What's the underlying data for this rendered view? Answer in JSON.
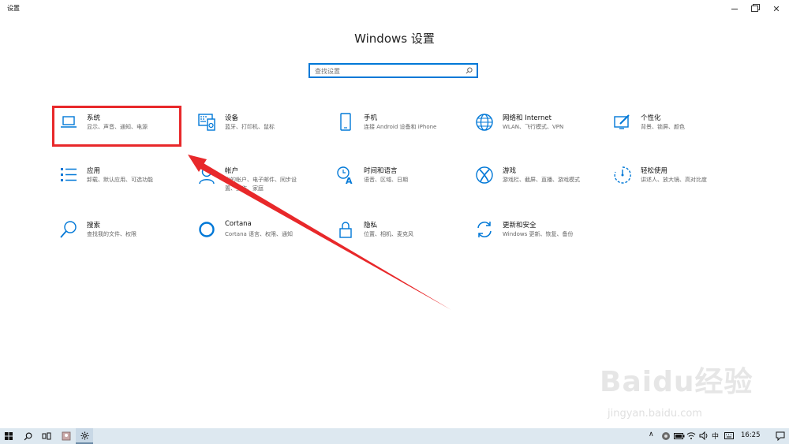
{
  "window": {
    "title": "设置",
    "controls": {
      "minimize_glyph": "",
      "maximize_glyph": "",
      "close_glyph": "✕"
    }
  },
  "heading": "Windows 设置",
  "search": {
    "placeholder": "查找设置",
    "icon": "search-icon"
  },
  "tiles": [
    {
      "id": "system",
      "name": "系统",
      "desc": "显示、声音、通知、电源",
      "icon": "laptop-icon"
    },
    {
      "id": "devices",
      "name": "设备",
      "desc": "蓝牙、打印机、鼠标",
      "icon": "keyboard-speaker-icon"
    },
    {
      "id": "phone",
      "name": "手机",
      "desc": "连接 Android 设备和 iPhone",
      "icon": "phone-icon"
    },
    {
      "id": "network",
      "name": "网络和 Internet",
      "desc": "WLAN、飞行模式、VPN",
      "icon": "globe-icon"
    },
    {
      "id": "personalization",
      "name": "个性化",
      "desc": "背景、锁屏、颜色",
      "icon": "paint-icon"
    },
    {
      "id": "apps",
      "name": "应用",
      "desc": "卸载、默认应用、可选功能",
      "icon": "app-list-icon"
    },
    {
      "id": "accounts",
      "name": "帐户",
      "desc": "你的帐户、电子邮件、同步设\n置、工作、家庭",
      "icon": "person-icon"
    },
    {
      "id": "time-language",
      "name": "时间和语言",
      "desc": "语音、区域、日期",
      "icon": "time-language-icon"
    },
    {
      "id": "gaming",
      "name": "游戏",
      "desc": "游戏栏、截屏、直播、游戏模式",
      "icon": "xbox-icon"
    },
    {
      "id": "ease-of-access",
      "name": "轻松使用",
      "desc": "讲述人、放大镜、高对比度",
      "icon": "ease-of-access-icon"
    },
    {
      "id": "search",
      "name": "搜索",
      "desc": "查找我的文件、权限",
      "icon": "search-icon"
    },
    {
      "id": "cortana",
      "name": "Cortana",
      "desc": "Cortana 语言、权限、通知",
      "icon": "cortana-icon"
    },
    {
      "id": "privacy",
      "name": "隐私",
      "desc": "位置、相机、麦克风",
      "icon": "lock-icon"
    },
    {
      "id": "update-security",
      "name": "更新和安全",
      "desc": "Windows 更新、恢复、备份",
      "icon": "sync-icon"
    }
  ],
  "annotation": {
    "highlight_color": "#e8282a"
  },
  "watermark": {
    "logo": "Baidu经验",
    "url": "jingyan.baidu.com"
  },
  "taskbar": {
    "items": [
      "windows-start-icon",
      "search-icon",
      "task-view-icon",
      "app-icon",
      "settings-gear-icon"
    ],
    "tray": {
      "chevron": "∧",
      "ime": "中",
      "time": "16:25"
    }
  },
  "colors": {
    "accent": "#0078d7",
    "taskbar": "#dde8f0"
  }
}
